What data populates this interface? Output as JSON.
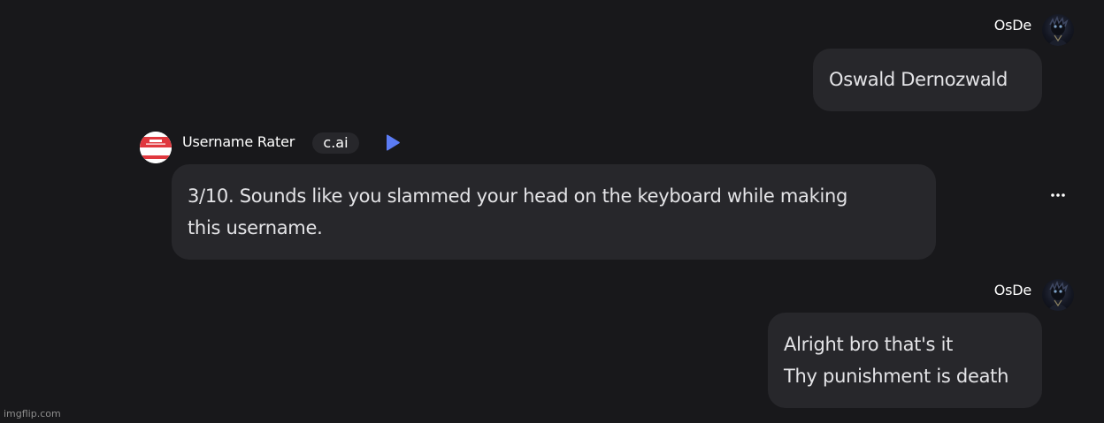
{
  "messages": [
    {
      "author": "OsDe",
      "lines": [
        "Oswald Dernozwald"
      ]
    },
    {
      "author": "Username Rater",
      "badge": "c.ai",
      "lines": [
        "3/10. Sounds like you slammed your head on the keyboard while making",
        "this username."
      ]
    },
    {
      "author": "OsDe",
      "lines": [
        "Alright bro that's it",
        "Thy punishment is death"
      ]
    }
  ],
  "icons": {
    "user_avatar": "user-avatar-dark-figure",
    "bot_avatar": "hello-name-tag-sticker",
    "play": "play-icon",
    "more": "more-options-icon"
  },
  "colors": {
    "background": "#18181b",
    "bubble": "#27272b",
    "play_accent": "#5b7cf5",
    "name_tag_red": "#e0383e"
  },
  "watermark": "imgflip.com"
}
